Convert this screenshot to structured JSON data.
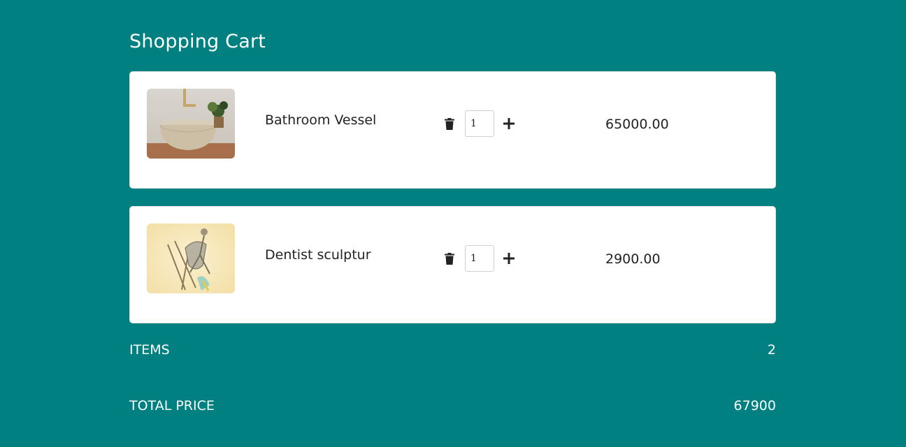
{
  "cart": {
    "title": "Shopping Cart",
    "items": [
      {
        "name": "Bathroom Vessel",
        "quantity": "1",
        "price": "65000.00",
        "image_icon": "bathroom-vessel-photo"
      },
      {
        "name": "Dentist sculptur",
        "quantity": "1",
        "price": "2900.00",
        "image_icon": "dentist-sculpture-photo"
      }
    ],
    "controls": {
      "delete_icon": "trash-icon",
      "increment_icon": "plus-icon"
    }
  },
  "summary": {
    "items_label": "ITEMS",
    "items_count": "2",
    "total_label": "TOTAL PRICE",
    "total_value": "67900"
  },
  "colors": {
    "background": "#008080",
    "card": "#ffffff",
    "text_dark": "#222222",
    "text_light": "#ffffff"
  }
}
